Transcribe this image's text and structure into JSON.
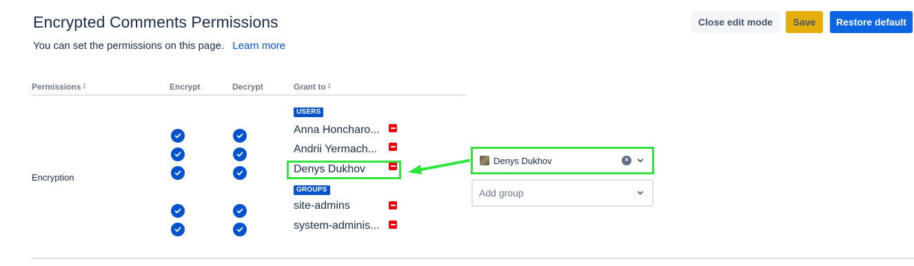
{
  "header": {
    "title": "Encrypted Comments Permissions",
    "subtitle": "You can set the permissions on this page.",
    "learn_more": "Learn more"
  },
  "toolbar": {
    "close_edit_mode": "Close edit mode",
    "save": "Save",
    "restore_default": "Restore default"
  },
  "table": {
    "columns": [
      "Permissions",
      "Encrypt",
      "Decrypt",
      "Grant to"
    ],
    "rows": [
      {
        "permission": "Encryption",
        "users_label": "USERS",
        "users": [
          "Anna Honcharo...",
          "Andrii Yermach...",
          "Denys Dukhov"
        ],
        "groups_label": "GROUPS",
        "groups": [
          "site-admins",
          "system-adminis..."
        ]
      }
    ]
  },
  "editor": {
    "user_select_value": "Denys Dukhov",
    "group_select_placeholder": "Add group"
  },
  "colors": {
    "accent": "#0052cc",
    "primary_button": "#0c66e4",
    "save_button": "#e3ae0a",
    "remove": "#e5000f",
    "highlight": "#2ee63b"
  },
  "icons": {
    "check": "check-circle-icon",
    "remove": "remove-icon",
    "sort": "sort-icon",
    "clear": "clear-icon",
    "chevron": "chevron-down-icon"
  }
}
